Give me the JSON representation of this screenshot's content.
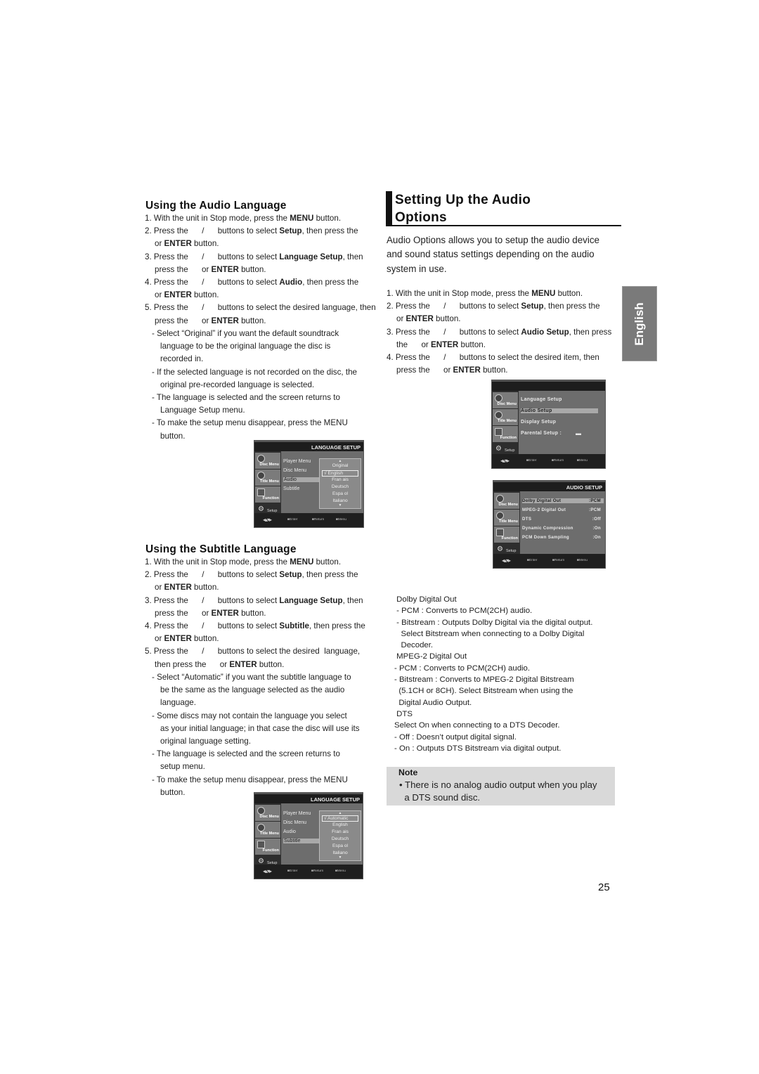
{
  "left": {
    "audio_language": {
      "heading": "Using the Audio Language",
      "steps": [
        {
          "pre": "1. With the unit in Stop mode, press the ",
          "bold": "MENU",
          "post": " button."
        },
        {
          "pre": "2. Press the      /      buttons to select ",
          "bold": "Setup",
          "post": ", then press the"
        },
        {
          "pre": "or ",
          "bold": "ENTER",
          "post": " button."
        },
        {
          "pre": "3. Press the      /      buttons to select ",
          "bold": "Language Setup",
          "post": ", then"
        },
        {
          "pre": "press the      or ",
          "bold": "ENTER",
          "post": " button."
        },
        {
          "pre": "4. Press the      /      buttons to select ",
          "bold": "Audio",
          "post": ", then press the"
        },
        {
          "pre": "or ",
          "bold": "ENTER",
          "post": " button."
        },
        {
          "pre": "5. Press the      /      buttons to select the desired language, then",
          "bold": "",
          "post": ""
        },
        {
          "pre": "press the      or ",
          "bold": "ENTER",
          "post": " button."
        }
      ],
      "bullets": [
        [
          "- Select “Original” if you want the default soundtrack",
          "language to be the original language the disc is",
          "recorded in."
        ],
        [
          "- If the selected language is not recorded on the disc, the",
          "original pre-recorded language is selected."
        ],
        [
          "- The language is selected and the screen returns to",
          "Language Setup menu."
        ],
        [
          "- To make the setup menu disappear, press the MENU",
          "button."
        ]
      ]
    },
    "subtitle_language": {
      "heading": "Using the Subtitle Language",
      "steps": [
        {
          "pre": "1. With the unit in Stop mode, press the ",
          "bold": "MENU",
          "post": " button."
        },
        {
          "pre": "2. Press the      /      buttons to select ",
          "bold": "Setup",
          "post": ", then press the"
        },
        {
          "pre": "or ",
          "bold": "ENTER",
          "post": " button."
        },
        {
          "pre": "3. Press the      /      buttons to select ",
          "bold": "Language Setup",
          "post": ", then"
        },
        {
          "pre": "press the      or ",
          "bold": "ENTER",
          "post": " button."
        },
        {
          "pre": "4. Press the      /      buttons to select ",
          "bold": "Subtitle",
          "post": ", then press the"
        },
        {
          "pre": "or ",
          "bold": "ENTER",
          "post": " button."
        },
        {
          "pre": "5. Press the      /      buttons to select the desired  language,",
          "bold": "",
          "post": ""
        },
        {
          "pre": "then press the      or ",
          "bold": "ENTER",
          "post": " button."
        }
      ],
      "bullets": [
        [
          "- Select “Automatic” if you want the subtitle  language to",
          "be the same as the language selected as the audio",
          "language."
        ],
        [
          "-  Some discs may not contain the language you  select",
          "as your initial language; in that case the disc will use its",
          "original language setting."
        ],
        [
          "- The language is selected and the screen returns to",
          "setup menu."
        ],
        [
          "- To make the setup menu disappear, press the MENU",
          "button."
        ]
      ]
    }
  },
  "osd_common": {
    "side_tabs": [
      "Disc Menu",
      "Title Menu",
      "Function"
    ],
    "setup_label": "Setup",
    "footer": {
      "nav_icon": "•▴•",
      "enter": "Enter",
      "return": "Return",
      "menu": "Menu"
    },
    "arrow_up": "▲",
    "arrow_down": "▼"
  },
  "osd_audio_lang": {
    "title": "LANGUAGE SETUP",
    "items": [
      "Player Menu",
      "Disc Menu",
      "Audio",
      "Subtitle"
    ],
    "selected_item": "Audio",
    "options": [
      "Original",
      "√ English",
      "Fran ais",
      "Deutsch",
      "Espa ol",
      "Italiano"
    ],
    "checked_option": "√ English"
  },
  "osd_subtitle_lang": {
    "title": "LANGUAGE SETUP",
    "items": [
      "Player Menu",
      "Disc Menu",
      "Audio",
      "Subtitle"
    ],
    "selected_item": "Subtitle",
    "options": [
      "√ Automatic",
      "English",
      "Fran ais",
      "Deutsch",
      "Espa ol",
      "Italiano"
    ],
    "checked_option": "√ Automatic"
  },
  "osd_setup": {
    "title": "",
    "items": [
      "Language Setup",
      "Audio Setup",
      "Display Setup",
      "Parental Setup :"
    ],
    "selected_item": "Audio Setup",
    "lock_icon": "lock-open"
  },
  "osd_audio_setup": {
    "title": "AUDIO SETUP",
    "items": [
      {
        "label": "Dolby Digital Out",
        "value": ":PCM"
      },
      {
        "label": "MPEG-2 Digital Out",
        "value": ":PCM"
      },
      {
        "label": "DTS",
        "value": ":Off"
      },
      {
        "label": "Dynamic Compression",
        "value": ":On"
      },
      {
        "label": "PCM Down Sampling",
        "value": ":On"
      }
    ],
    "selected_item": "Dolby Digital Out"
  },
  "right": {
    "section_title_line1": "Setting Up the Audio",
    "section_title_line2": "Options",
    "intro": [
      "Audio Options allows you to setup the audio device",
      "and sound status settings depending on the audio",
      "system in use."
    ],
    "steps": [
      {
        "pre": "1. With the unit in Stop mode, press the ",
        "bold": "MENU",
        "post": " button."
      },
      {
        "pre": "2. Press the      /      buttons to select ",
        "bold": "Setup",
        "post": ", then press the"
      },
      {
        "pre": "or ",
        "bold": "ENTER",
        "post": " button."
      },
      {
        "pre": "3. Press the      /      buttons to select ",
        "bold": "Audio Setup",
        "post": ", then press"
      },
      {
        "pre": "the      or ",
        "bold": "ENTER",
        "post": " button."
      },
      {
        "pre": "4. Press the      /      buttons to select the desired item, then",
        "bold": "",
        "post": ""
      },
      {
        "pre": "press the      or ",
        "bold": "ENTER",
        "post": " button."
      }
    ],
    "descriptions": [
      " Dolby Digital Out",
      " - PCM : Converts to PCM(2CH) audio.",
      " - Bitstream : Outputs Dolby Digital via the digital output.",
      "   Select Bitstream when connecting to a Dolby Digital",
      "   Decoder.",
      " MPEG-2 Digital Out",
      "- PCM : Converts to PCM(2CH) audio.",
      "- Bitstream : Converts to MPEG-2 Digital Bitstream",
      "  (5.1CH or 8CH). Select Bitstream when using the",
      "  Digital Audio Output.",
      " DTS",
      "Select On when connecting to a DTS Decoder.",
      "- Off : Doesn’t output digital signal.",
      "- On : Outputs DTS Bitstream via digital output."
    ],
    "note": {
      "title": "Note",
      "lines": [
        "• There is no analog audio output when you play",
        "  a DTS sound disc."
      ]
    }
  },
  "language_tab": "English",
  "page_number": "25"
}
